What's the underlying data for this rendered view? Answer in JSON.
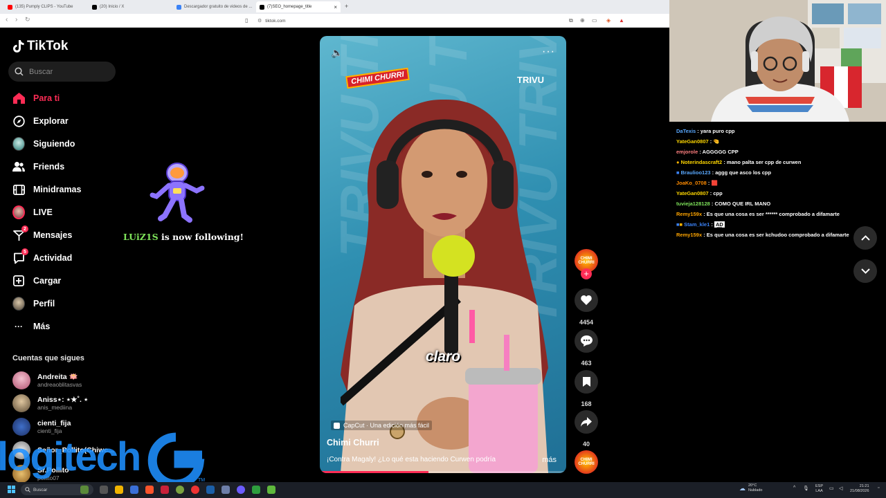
{
  "browser": {
    "tabs": [
      {
        "label": "(135) Pumply CLIPS - YouTube",
        "color": "#ff0000"
      },
      {
        "label": "(20) Inicio / X",
        "color": "#000000"
      },
      {
        "label": "Descargador gratuito de videos de ...",
        "color": "#3b82f6"
      },
      {
        "label": "(7)SEO_homepage_title",
        "color": "#000000"
      }
    ],
    "new_tab": "+",
    "url": "tiktok.com"
  },
  "tiktok": {
    "logo_text": "TikTok",
    "search_placeholder": "Buscar",
    "nav": [
      {
        "label": "Para ti",
        "icon": "home-icon",
        "glyph": "⌂"
      },
      {
        "label": "Explorar",
        "icon": "compass-icon",
        "glyph": "◎"
      },
      {
        "label": "Siguiendo",
        "icon": "following-avatar",
        "glyph": ""
      },
      {
        "label": "Friends",
        "icon": "friends-icon",
        "glyph": "👥"
      },
      {
        "label": "Minidramas",
        "icon": "film-icon",
        "glyph": "▦"
      },
      {
        "label": "LIVE",
        "icon": "live-avatar",
        "glyph": ""
      },
      {
        "label": "Mensajes",
        "icon": "inbox-icon",
        "glyph": "▽",
        "badge": "2"
      },
      {
        "label": "Actividad",
        "icon": "activity-icon",
        "glyph": "☐",
        "badge": "5"
      },
      {
        "label": "Cargar",
        "icon": "upload-icon",
        "glyph": "⊞"
      },
      {
        "label": "Perfil",
        "icon": "profile-avatar",
        "glyph": ""
      },
      {
        "label": "Más",
        "icon": "more-icon",
        "glyph": "···"
      }
    ],
    "following_title": "Cuentas que sigues",
    "following": [
      {
        "name": "Andreita 🪷",
        "user": "andreaoblitasvas",
        "color": "#c56a8a"
      },
      {
        "name": "Aniss⋆: ⋆★˚. ⋆",
        "user": "anis_mediina",
        "color": "#8d7b63"
      },
      {
        "name": "cienti_fija",
        "user": "cienti_fija",
        "color": "#2c4f8f"
      },
      {
        "name": "Señor_Pollito(Chiwc...",
        "user": "",
        "color": "#aaaaaa"
      },
      {
        "name": "Sr.Pollito",
        "user": "pollito07",
        "color": "#c99a4e"
      }
    ]
  },
  "alert": {
    "username": "LUiZ1S",
    "message": " is now following!"
  },
  "video": {
    "brand_left": "CHIMI CHURRI",
    "brand_right": "TRIVU",
    "caption": "claro",
    "capcut": "CapCut · Una edición más fácil",
    "author": "Chimi Churri",
    "description": "¡Contra Magaly! ¿Lo qué esta haciendo Curwen podría",
    "more": "más",
    "progress": 0.44
  },
  "actions": {
    "creator_badge": "CHIMI CHURRI",
    "likes": "4454",
    "comments": "463",
    "saves": "168",
    "shares": "40"
  },
  "chat": [
    {
      "user": "DaTexis",
      "color": "#5aa9ff",
      "msg": "yara puro cpp"
    },
    {
      "user": "YateGan0807",
      "color": "#ffd700",
      "msg": "🤏"
    },
    {
      "user": "emjorole",
      "color": "#ff7f7f",
      "msg": "AGGGGG CPP"
    },
    {
      "user": "Noterindascraft2",
      "color": "#ffd700",
      "msg": "mano palta ser cpp de curwen"
    },
    {
      "user": "Braulioo123",
      "color": "#5aa9ff",
      "msg": "aggg que asco los cpp"
    },
    {
      "user": "JoaKo_0708",
      "color": "#ff8c00",
      "msg": "🟥"
    },
    {
      "user": "YateGan0807",
      "color": "#ffd700",
      "msg": "cpp"
    },
    {
      "user": "tuvieja128128",
      "color": "#7ee35a",
      "msg": "COMO QUE IRL MANO"
    },
    {
      "user": "Remy159x",
      "color": "#ffa500",
      "msg": "Es que una cosa es ser ****** comprobado a difamarte"
    },
    {
      "user": "Stam_kle1",
      "color": "#3b82f6",
      "msg": "A͟D"
    },
    {
      "user": "Remy159x",
      "color": "#ffa500",
      "msg": "Es que una cosa es ser kchudoo comprobado a difamarte"
    }
  ],
  "taskbar": {
    "search_placeholder": "Buscar",
    "weather_temp": "20°C",
    "weather_text": "Nublado",
    "lang1": "ESP",
    "lang2": "LAA",
    "time": "21:21",
    "date": "21/08/2026"
  },
  "watermark": {
    "text": "logitech",
    "tm": "TM"
  }
}
